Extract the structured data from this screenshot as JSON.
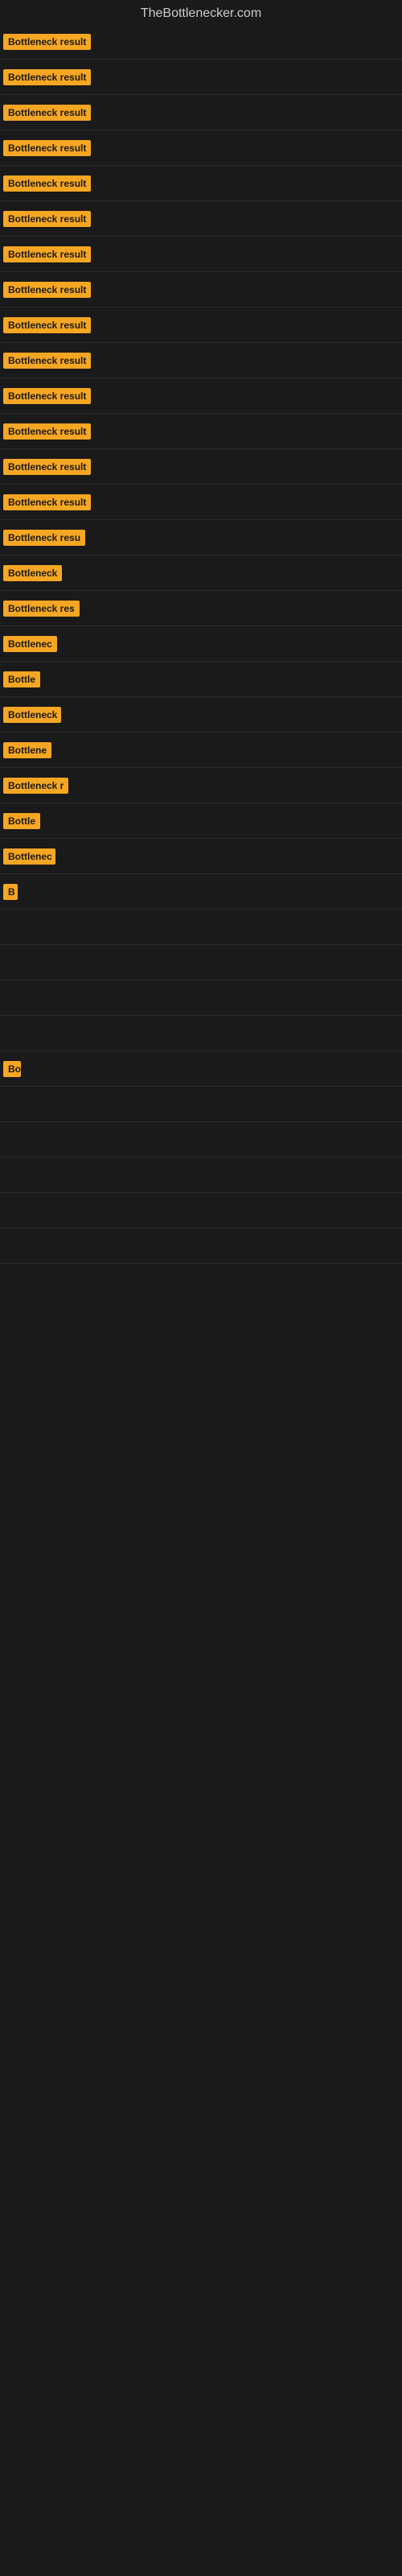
{
  "site": {
    "title": "TheBottlenecker.com"
  },
  "rows": [
    {
      "id": 1,
      "label": "Bottleneck result",
      "width": 120
    },
    {
      "id": 2,
      "label": "Bottleneck result",
      "width": 120
    },
    {
      "id": 3,
      "label": "Bottleneck result",
      "width": 120
    },
    {
      "id": 4,
      "label": "Bottleneck result",
      "width": 120
    },
    {
      "id": 5,
      "label": "Bottleneck result",
      "width": 120
    },
    {
      "id": 6,
      "label": "Bottleneck result",
      "width": 120
    },
    {
      "id": 7,
      "label": "Bottleneck result",
      "width": 120
    },
    {
      "id": 8,
      "label": "Bottleneck result",
      "width": 120
    },
    {
      "id": 9,
      "label": "Bottleneck result",
      "width": 120
    },
    {
      "id": 10,
      "label": "Bottleneck result",
      "width": 120
    },
    {
      "id": 11,
      "label": "Bottleneck result",
      "width": 120
    },
    {
      "id": 12,
      "label": "Bottleneck result",
      "width": 120
    },
    {
      "id": 13,
      "label": "Bottleneck result",
      "width": 120
    },
    {
      "id": 14,
      "label": "Bottleneck result",
      "width": 120
    },
    {
      "id": 15,
      "label": "Bottleneck resu",
      "width": 105
    },
    {
      "id": 16,
      "label": "Bottleneck",
      "width": 75
    },
    {
      "id": 17,
      "label": "Bottleneck res",
      "width": 95
    },
    {
      "id": 18,
      "label": "Bottlenec",
      "width": 68
    },
    {
      "id": 19,
      "label": "Bottle",
      "width": 50
    },
    {
      "id": 20,
      "label": "Bottleneck",
      "width": 72
    },
    {
      "id": 21,
      "label": "Bottlene",
      "width": 60
    },
    {
      "id": 22,
      "label": "Bottleneck r",
      "width": 82
    },
    {
      "id": 23,
      "label": "Bottle",
      "width": 48
    },
    {
      "id": 24,
      "label": "Bottlenec",
      "width": 65
    },
    {
      "id": 25,
      "label": "B",
      "width": 18
    },
    {
      "id": 26,
      "label": "",
      "width": 0
    },
    {
      "id": 27,
      "label": "",
      "width": 0
    },
    {
      "id": 28,
      "label": "",
      "width": 0
    },
    {
      "id": 29,
      "label": "",
      "width": 0
    },
    {
      "id": 30,
      "label": "Bo",
      "width": 22
    },
    {
      "id": 31,
      "label": "",
      "width": 0
    },
    {
      "id": 32,
      "label": "",
      "width": 0
    },
    {
      "id": 33,
      "label": "",
      "width": 0
    },
    {
      "id": 34,
      "label": "",
      "width": 0
    },
    {
      "id": 35,
      "label": "",
      "width": 0
    }
  ]
}
